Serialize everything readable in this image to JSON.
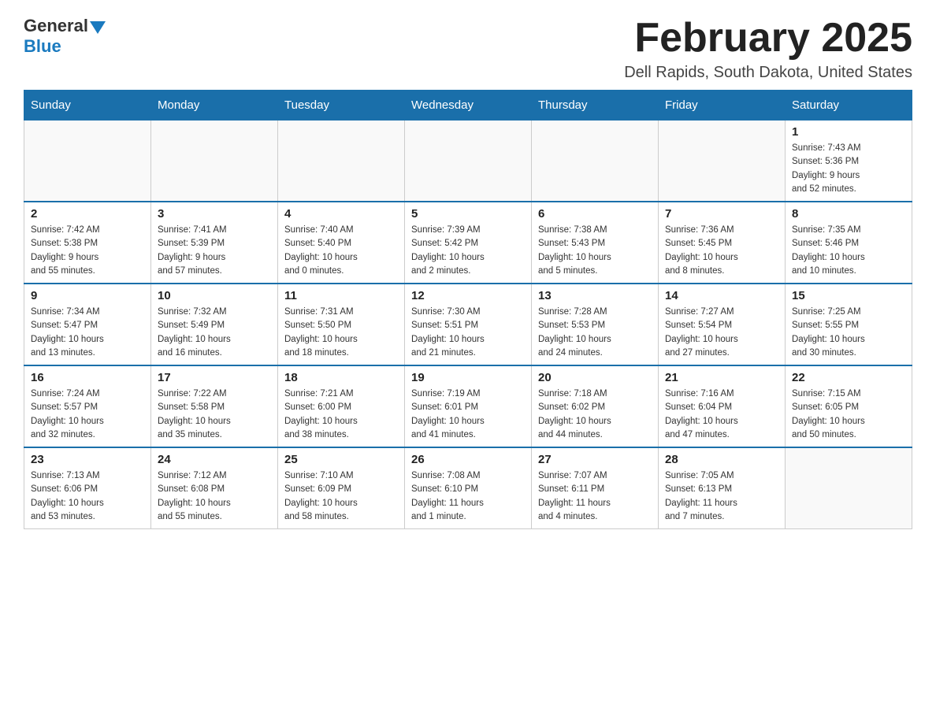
{
  "header": {
    "logo_general": "General",
    "logo_blue": "Blue",
    "month_title": "February 2025",
    "location": "Dell Rapids, South Dakota, United States"
  },
  "days_of_week": [
    "Sunday",
    "Monday",
    "Tuesday",
    "Wednesday",
    "Thursday",
    "Friday",
    "Saturday"
  ],
  "weeks": [
    [
      {
        "day": "",
        "info": ""
      },
      {
        "day": "",
        "info": ""
      },
      {
        "day": "",
        "info": ""
      },
      {
        "day": "",
        "info": ""
      },
      {
        "day": "",
        "info": ""
      },
      {
        "day": "",
        "info": ""
      },
      {
        "day": "1",
        "info": "Sunrise: 7:43 AM\nSunset: 5:36 PM\nDaylight: 9 hours\nand 52 minutes."
      }
    ],
    [
      {
        "day": "2",
        "info": "Sunrise: 7:42 AM\nSunset: 5:38 PM\nDaylight: 9 hours\nand 55 minutes."
      },
      {
        "day": "3",
        "info": "Sunrise: 7:41 AM\nSunset: 5:39 PM\nDaylight: 9 hours\nand 57 minutes."
      },
      {
        "day": "4",
        "info": "Sunrise: 7:40 AM\nSunset: 5:40 PM\nDaylight: 10 hours\nand 0 minutes."
      },
      {
        "day": "5",
        "info": "Sunrise: 7:39 AM\nSunset: 5:42 PM\nDaylight: 10 hours\nand 2 minutes."
      },
      {
        "day": "6",
        "info": "Sunrise: 7:38 AM\nSunset: 5:43 PM\nDaylight: 10 hours\nand 5 minutes."
      },
      {
        "day": "7",
        "info": "Sunrise: 7:36 AM\nSunset: 5:45 PM\nDaylight: 10 hours\nand 8 minutes."
      },
      {
        "day": "8",
        "info": "Sunrise: 7:35 AM\nSunset: 5:46 PM\nDaylight: 10 hours\nand 10 minutes."
      }
    ],
    [
      {
        "day": "9",
        "info": "Sunrise: 7:34 AM\nSunset: 5:47 PM\nDaylight: 10 hours\nand 13 minutes."
      },
      {
        "day": "10",
        "info": "Sunrise: 7:32 AM\nSunset: 5:49 PM\nDaylight: 10 hours\nand 16 minutes."
      },
      {
        "day": "11",
        "info": "Sunrise: 7:31 AM\nSunset: 5:50 PM\nDaylight: 10 hours\nand 18 minutes."
      },
      {
        "day": "12",
        "info": "Sunrise: 7:30 AM\nSunset: 5:51 PM\nDaylight: 10 hours\nand 21 minutes."
      },
      {
        "day": "13",
        "info": "Sunrise: 7:28 AM\nSunset: 5:53 PM\nDaylight: 10 hours\nand 24 minutes."
      },
      {
        "day": "14",
        "info": "Sunrise: 7:27 AM\nSunset: 5:54 PM\nDaylight: 10 hours\nand 27 minutes."
      },
      {
        "day": "15",
        "info": "Sunrise: 7:25 AM\nSunset: 5:55 PM\nDaylight: 10 hours\nand 30 minutes."
      }
    ],
    [
      {
        "day": "16",
        "info": "Sunrise: 7:24 AM\nSunset: 5:57 PM\nDaylight: 10 hours\nand 32 minutes."
      },
      {
        "day": "17",
        "info": "Sunrise: 7:22 AM\nSunset: 5:58 PM\nDaylight: 10 hours\nand 35 minutes."
      },
      {
        "day": "18",
        "info": "Sunrise: 7:21 AM\nSunset: 6:00 PM\nDaylight: 10 hours\nand 38 minutes."
      },
      {
        "day": "19",
        "info": "Sunrise: 7:19 AM\nSunset: 6:01 PM\nDaylight: 10 hours\nand 41 minutes."
      },
      {
        "day": "20",
        "info": "Sunrise: 7:18 AM\nSunset: 6:02 PM\nDaylight: 10 hours\nand 44 minutes."
      },
      {
        "day": "21",
        "info": "Sunrise: 7:16 AM\nSunset: 6:04 PM\nDaylight: 10 hours\nand 47 minutes."
      },
      {
        "day": "22",
        "info": "Sunrise: 7:15 AM\nSunset: 6:05 PM\nDaylight: 10 hours\nand 50 minutes."
      }
    ],
    [
      {
        "day": "23",
        "info": "Sunrise: 7:13 AM\nSunset: 6:06 PM\nDaylight: 10 hours\nand 53 minutes."
      },
      {
        "day": "24",
        "info": "Sunrise: 7:12 AM\nSunset: 6:08 PM\nDaylight: 10 hours\nand 55 minutes."
      },
      {
        "day": "25",
        "info": "Sunrise: 7:10 AM\nSunset: 6:09 PM\nDaylight: 10 hours\nand 58 minutes."
      },
      {
        "day": "26",
        "info": "Sunrise: 7:08 AM\nSunset: 6:10 PM\nDaylight: 11 hours\nand 1 minute."
      },
      {
        "day": "27",
        "info": "Sunrise: 7:07 AM\nSunset: 6:11 PM\nDaylight: 11 hours\nand 4 minutes."
      },
      {
        "day": "28",
        "info": "Sunrise: 7:05 AM\nSunset: 6:13 PM\nDaylight: 11 hours\nand 7 minutes."
      },
      {
        "day": "",
        "info": ""
      }
    ]
  ]
}
